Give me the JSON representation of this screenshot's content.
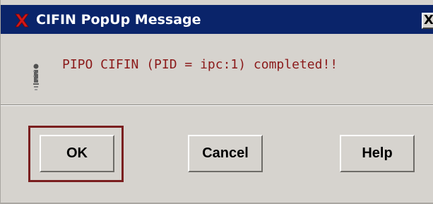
{
  "window": {
    "title": "CIFIN PopUp Message",
    "title_icon": "x-logo-icon",
    "close_label": "X"
  },
  "message": {
    "icon": "info-icon",
    "text": "PIPO CIFIN (PID = ipc:1) completed!!"
  },
  "buttons": {
    "ok_label": "OK",
    "cancel_label": "Cancel",
    "help_label": "Help",
    "default": "OK"
  },
  "colors": {
    "titlebar": "#0a246a",
    "message_text": "#8b1a1a",
    "default_ring": "#7a1f1f",
    "dialog_bg": "#d6d3ce"
  }
}
